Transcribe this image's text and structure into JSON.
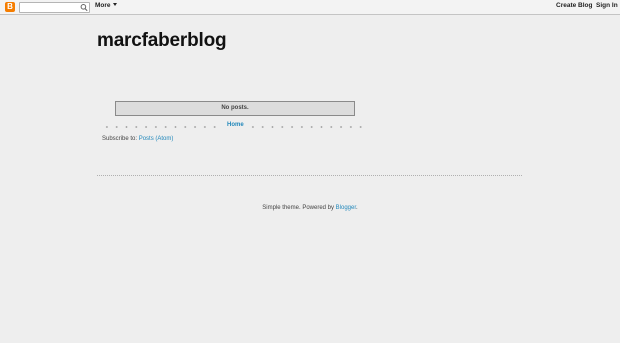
{
  "navbar": {
    "logo_letter": "B",
    "search": {
      "value": "",
      "placeholder": ""
    },
    "more_label": "More",
    "create_blog_label": "Create Blog",
    "sign_in_label": "Sign In"
  },
  "header": {
    "title": "marcfaberblog"
  },
  "main": {
    "status_message": "No posts.",
    "home_label": "Home",
    "subscribe_prefix": "Subscribe to: ",
    "feed_label": "Posts (Atom)"
  },
  "footer": {
    "attribution_prefix": "Simple theme. Powered by ",
    "blogger_label": "Blogger",
    "attribution_suffix": "."
  },
  "colors": {
    "background": "#eeeeee",
    "link": "#2288bb",
    "blogger_orange": "#f57d00"
  }
}
